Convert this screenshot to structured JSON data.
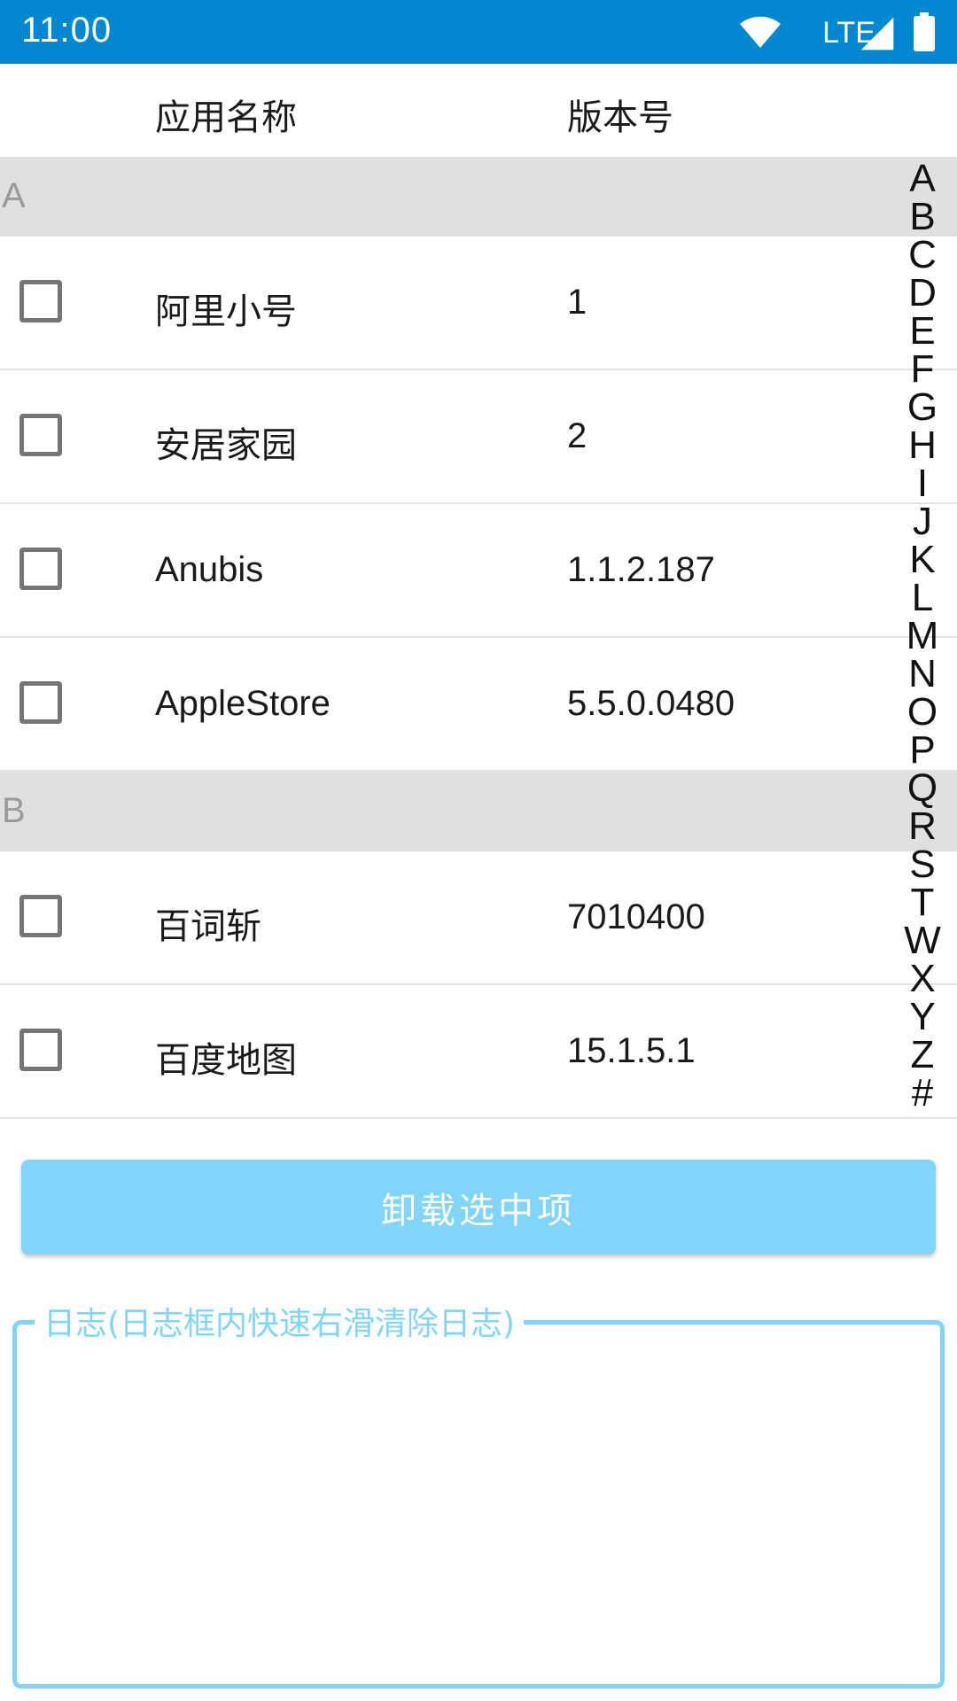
{
  "status_bar": {
    "time": "11:00",
    "network": "LTE",
    "bg_color": "#0288d1"
  },
  "header": {
    "col_name": "应用名称",
    "col_version": "版本号"
  },
  "sections": [
    {
      "letter": "A",
      "apps": [
        {
          "name": "阿里小号",
          "version": "1",
          "checked": false
        },
        {
          "name": "安居家园",
          "version": "2",
          "checked": false
        },
        {
          "name": "Anubis",
          "version": "1.1.2.187",
          "checked": false
        },
        {
          "name": "AppleStore",
          "version": "5.5.0.0480",
          "checked": false
        }
      ]
    },
    {
      "letter": "B",
      "apps": [
        {
          "name": "百词斩",
          "version": "7010400",
          "checked": false
        },
        {
          "name": "百度地图",
          "version": "15.1.5.1",
          "checked": false
        }
      ]
    }
  ],
  "index_letters": [
    "A",
    "B",
    "C",
    "D",
    "E",
    "F",
    "G",
    "H",
    "I",
    "J",
    "K",
    "L",
    "M",
    "N",
    "O",
    "P",
    "Q",
    "R",
    "S",
    "T",
    "W",
    "X",
    "Y",
    "Z",
    "#"
  ],
  "uninstall_button": {
    "label": "卸载选中项",
    "color": "#81d4fa"
  },
  "log": {
    "title": "日志(日志框内快速右滑清除日志)",
    "content": "",
    "color": "#81d4fa"
  }
}
